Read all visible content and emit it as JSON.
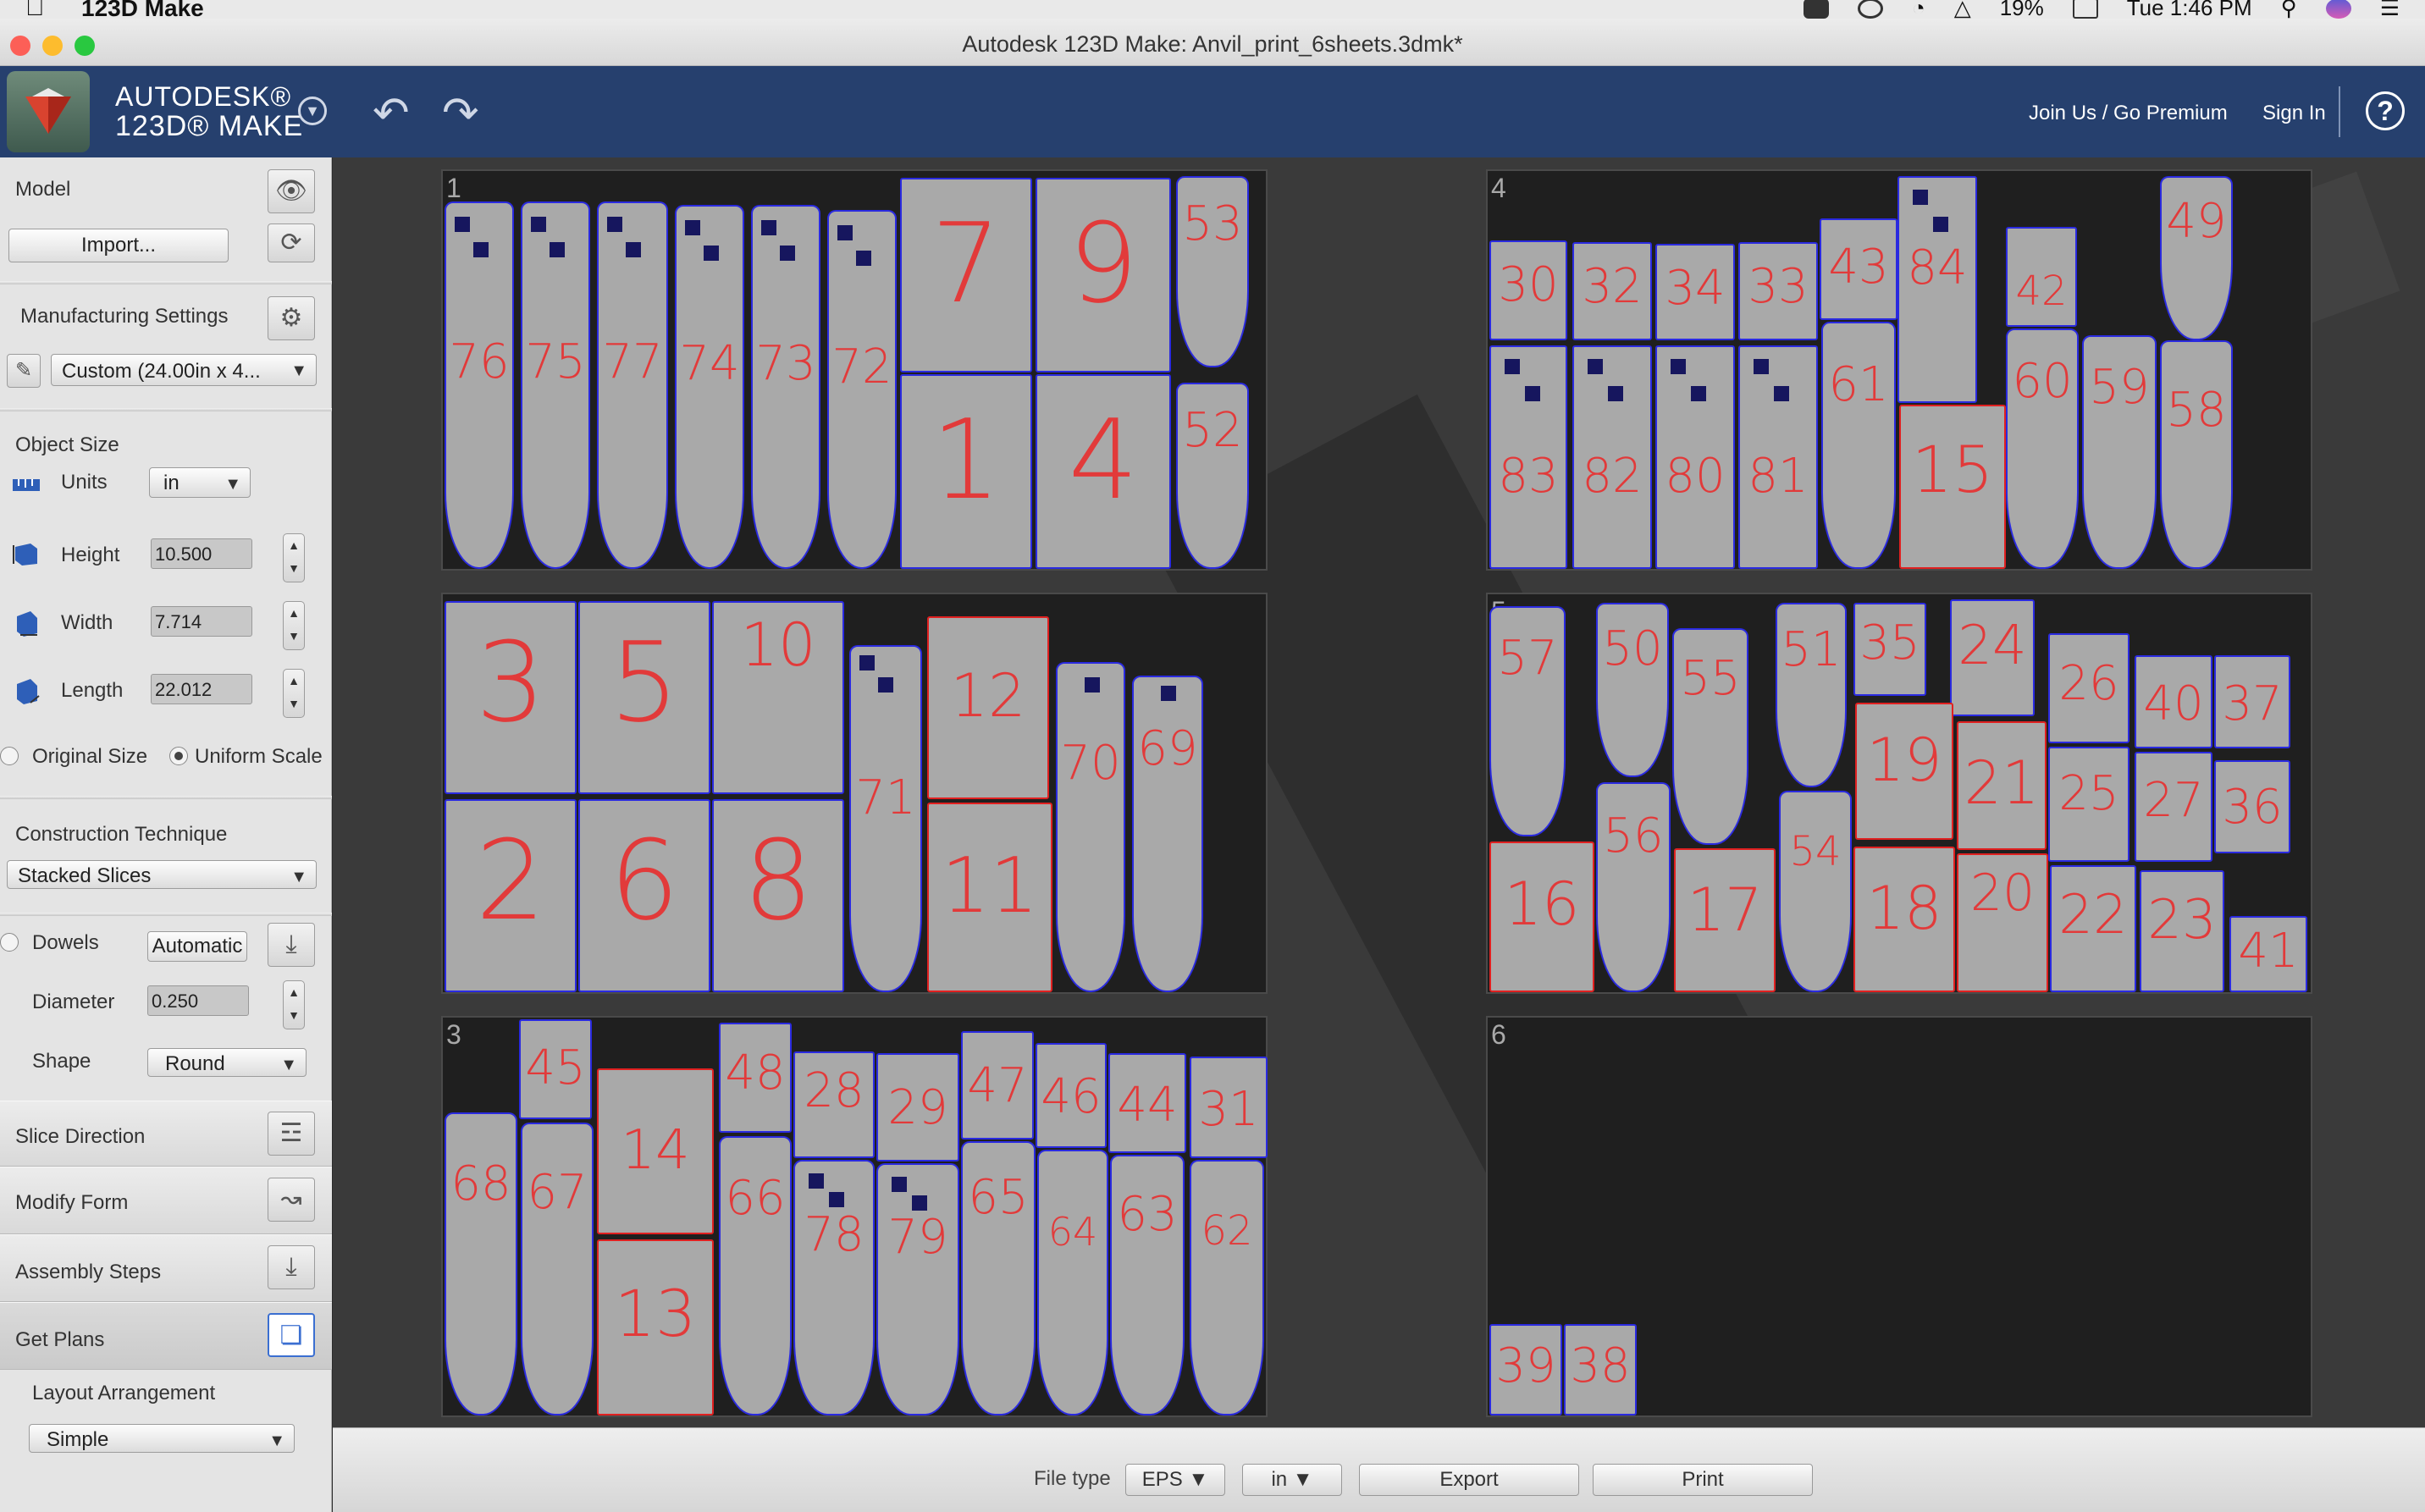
{
  "menubar": {
    "app_name": "123D Make",
    "battery": "19%",
    "time": "Tue 1:46 PM",
    "icons": [
      "evernote-icon",
      "creative-cloud-icon",
      "wifi-icon",
      "airplay-icon",
      "battery-icon",
      "spotlight-icon",
      "siri-icon",
      "menu-extra-icon"
    ]
  },
  "window": {
    "title": "Autodesk 123D Make: Anvil_print_6sheets.3dmk*"
  },
  "header": {
    "brand_top": "AUTODESK®",
    "brand_bottom": "123D® MAKE",
    "join_link": "Join Us / Go Premium",
    "signin_link": "Sign In",
    "help_label": "?"
  },
  "panel": {
    "model_label": "Model",
    "import_button": "Import...",
    "manufacturing_label": "Manufacturing Settings",
    "material_select": "Custom (24.00in x 4...",
    "object_size_label": "Object Size",
    "units_label": "Units",
    "units_value": "in",
    "height_label": "Height",
    "height_value": "10.500",
    "width_label": "Width",
    "width_value": "7.714",
    "length_label": "Length",
    "length_value": "22.012",
    "original_size_label": "Original Size",
    "uniform_scale_label": "Uniform Scale",
    "construction_label": "Construction Technique",
    "construction_value": "Stacked Slices",
    "dowels_label": "Dowels",
    "dowels_button": "Automatic",
    "diameter_label": "Diameter",
    "diameter_value": "0.250",
    "shape_label": "Shape",
    "shape_value": "Round",
    "slice_direction_label": "Slice Direction",
    "modify_form_label": "Modify Form",
    "assembly_steps_label": "Assembly Steps",
    "get_plans_label": "Get Plans",
    "layout_label": "Layout Arrangement",
    "layout_value": "Simple"
  },
  "sheets": [
    {
      "number": "1"
    },
    {
      "number": "2"
    },
    {
      "number": "3"
    },
    {
      "number": "4"
    },
    {
      "number": "5"
    },
    {
      "number": "6"
    }
  ],
  "parts": {
    "sheet1": [
      "76",
      "75",
      "77",
      "74",
      "73",
      "72",
      "7",
      "9",
      "53",
      "1",
      "4",
      "52"
    ],
    "sheet2": [
      "3",
      "5",
      "10",
      "71",
      "12",
      "70",
      "69",
      "2",
      "6",
      "8",
      "11"
    ],
    "sheet3": [
      "45",
      "14",
      "48",
      "28",
      "29",
      "47",
      "46",
      "44",
      "31",
      "68",
      "67",
      "66",
      "78",
      "79",
      "65",
      "64",
      "63",
      "62",
      "13"
    ],
    "sheet4": [
      "30",
      "32",
      "34",
      "33",
      "43",
      "84",
      "42",
      "49",
      "83",
      "82",
      "80",
      "81",
      "61",
      "15",
      "60",
      "59",
      "58"
    ],
    "sheet5": [
      "57",
      "50",
      "55",
      "51",
      "35",
      "24",
      "26",
      "40",
      "37",
      "19",
      "21",
      "25",
      "27",
      "36",
      "16",
      "56",
      "17",
      "54",
      "18",
      "20",
      "22",
      "23",
      "41"
    ],
    "sheet6": [
      "39",
      "38"
    ]
  },
  "bottombar": {
    "file_type_label": "File type",
    "file_type_value": "EPS",
    "unit_value": "in",
    "export_button": "Export",
    "print_button": "Print"
  }
}
